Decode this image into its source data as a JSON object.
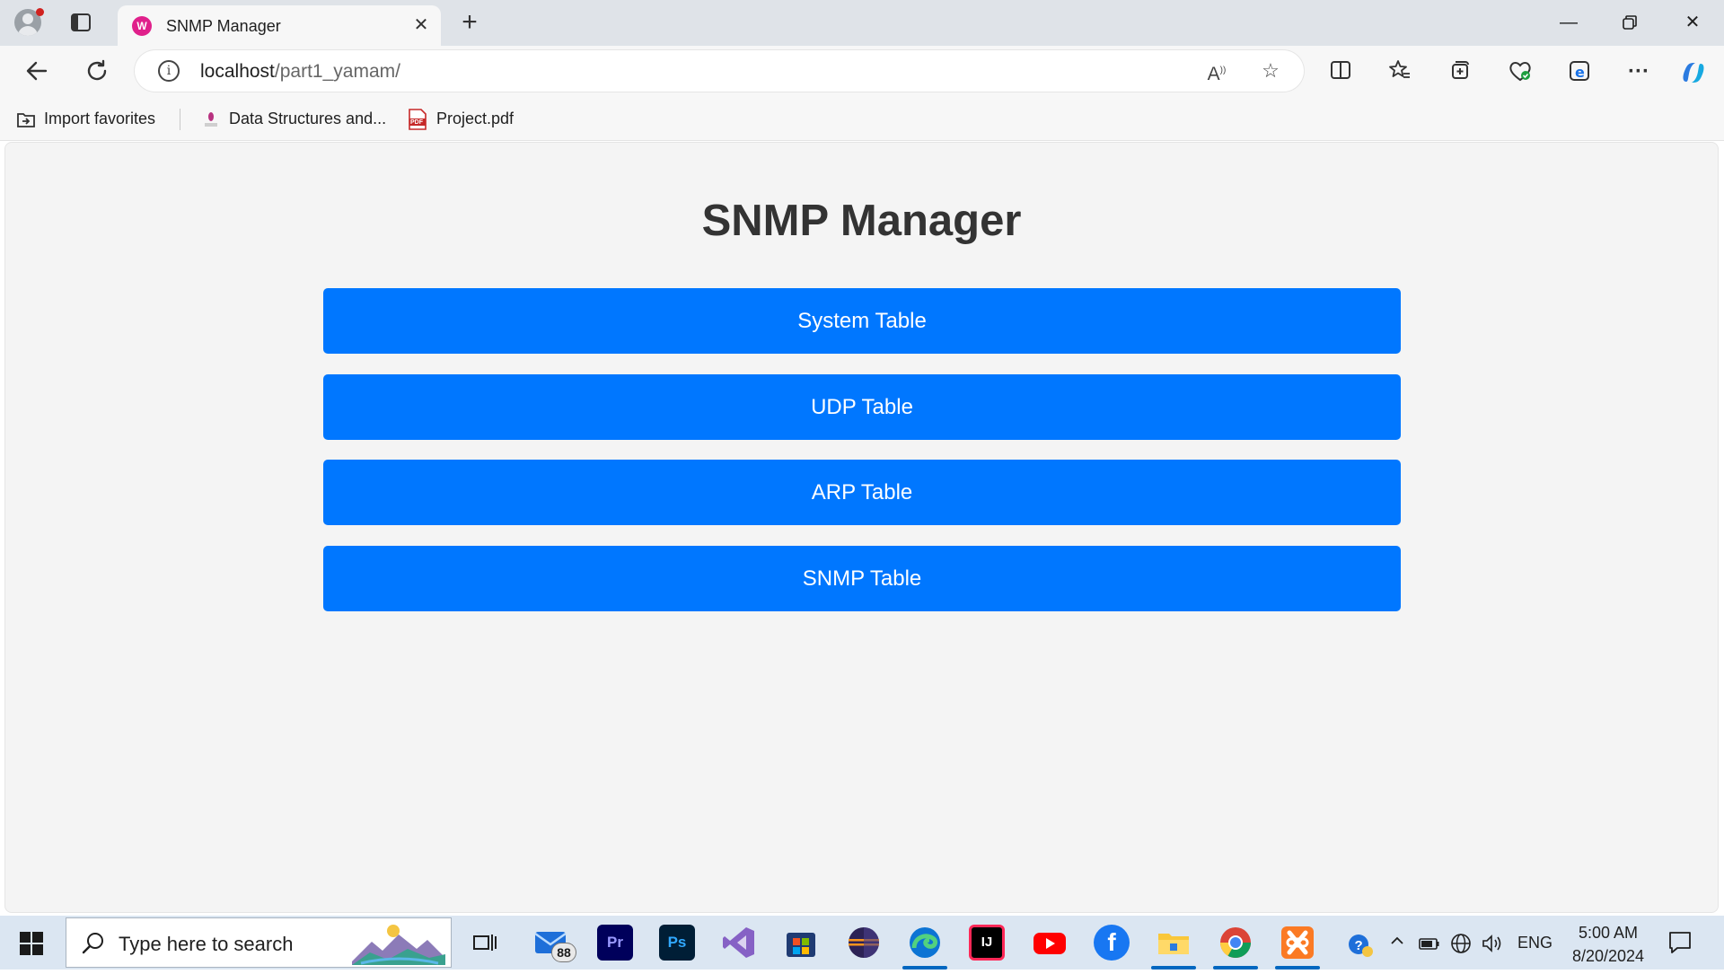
{
  "browser": {
    "tab": {
      "title": "SNMP Manager",
      "favicon_icon": "wamp-icon",
      "favicon_glyph": "W"
    },
    "address": {
      "host": "localhost",
      "path": "/part1_yamam/"
    },
    "read_aloud_glyph": "A",
    "favorites": [
      {
        "label": "Import favorites",
        "icon": "import-favorites-icon"
      },
      {
        "label": "Data Structures and...",
        "icon": "book-icon"
      },
      {
        "label": "Project.pdf",
        "icon": "pdf-icon",
        "icon_text": "PDF"
      }
    ]
  },
  "page": {
    "title": "SNMP Manager",
    "buttons": [
      {
        "label": "System Table"
      },
      {
        "label": "UDP Table"
      },
      {
        "label": "ARP Table"
      },
      {
        "label": "SNMP Table"
      }
    ],
    "accent_color": "#0077ff"
  },
  "taskbar": {
    "search_placeholder": "Type here to search",
    "mail_badge": "88",
    "apps": [
      {
        "name": "task-view",
        "icon": "task-view-icon"
      },
      {
        "name": "mail",
        "icon": "mail-icon"
      },
      {
        "name": "premiere-pro",
        "icon": "premiere-pro-icon",
        "glyph": "Pr"
      },
      {
        "name": "photoshop",
        "icon": "photoshop-icon",
        "glyph": "Ps"
      },
      {
        "name": "visual-studio",
        "icon": "visual-studio-icon"
      },
      {
        "name": "microsoft-store",
        "icon": "store-icon"
      },
      {
        "name": "eclipse",
        "icon": "eclipse-icon"
      },
      {
        "name": "edge",
        "icon": "edge-icon"
      },
      {
        "name": "intellij",
        "icon": "intellij-icon",
        "glyph": "IJ"
      },
      {
        "name": "youtube",
        "icon": "youtube-icon"
      },
      {
        "name": "facebook",
        "icon": "facebook-icon",
        "glyph": "f"
      },
      {
        "name": "file-explorer",
        "icon": "folder-icon"
      },
      {
        "name": "chrome",
        "icon": "chrome-icon"
      },
      {
        "name": "xampp",
        "icon": "xampp-icon"
      }
    ],
    "tray": {
      "language": "ENG"
    },
    "clock": {
      "time": "5:00 AM",
      "date": "8/20/2024"
    }
  }
}
